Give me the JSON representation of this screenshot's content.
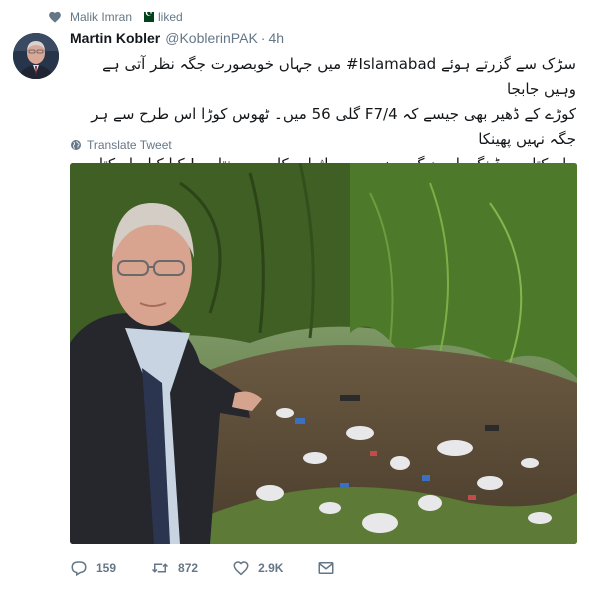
{
  "context": {
    "liker": "Malik Imran",
    "label": "liked"
  },
  "author": {
    "name": "Martin Kobler",
    "handle": "@KoblerinPAK",
    "separator": "·",
    "time": "4h"
  },
  "tweet": {
    "lines": [
      "سڑک سے گزرتے ہوئے Islamabad# میں جہاں خوبصورت جگہ نظر آتی ہے وہیں جابجا",
      "کوڑے کے ڈھیر بھی جیسے کہ F7/4 گلی 56 میں۔ ٹھوس کوڑا اس طرح سے ہر جگہ نہیں پھینکا",
      "جاسکتا۔ یہ ڈینگی اور دیگر مضر صحت اثرات کا سبب بنتا ہے! کیا کیا جاسکتا ہے؟"
    ],
    "translate_label": "Translate Tweet"
  },
  "stats": {
    "replies": "159",
    "retweets": "872",
    "likes": "2.9K"
  },
  "colors": {
    "text": "#14171a",
    "muted": "#657786",
    "retweet": "#657786",
    "link": "#1da1f2"
  },
  "icons": {
    "context": "heart-icon",
    "translate": "globe-icon",
    "reply": "reply-icon",
    "retweet": "retweet-icon",
    "like": "heart-outline-icon",
    "message": "envelope-icon",
    "menu": "chevron-down-icon"
  }
}
